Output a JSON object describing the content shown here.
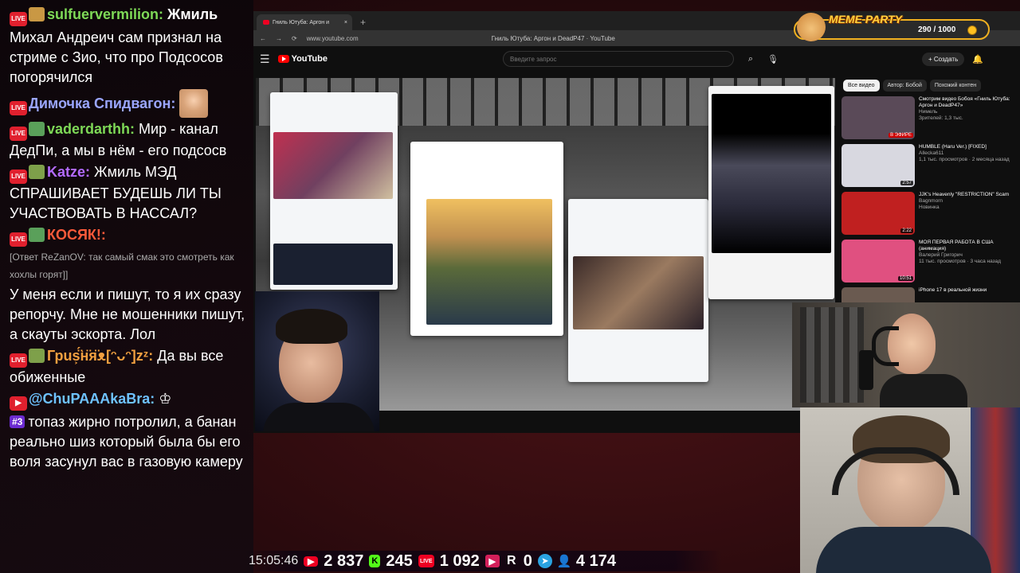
{
  "chat": {
    "messages": [
      {
        "badge": "LIVE",
        "user": "sulfuervermilion",
        "user_color": "#7ed957",
        "text": "Жмиль",
        "text_bold": true,
        "emote_color": "#c99844"
      },
      {
        "badge": "",
        "user": "",
        "text": "Михал Андреич сам признал на стриме с Зио, что про Подсосов погорячился"
      },
      {
        "badge": "LIVE",
        "user": "Димочка Спидвагон",
        "user_color": "#9aa6ff",
        "text": "",
        "has_avatar": true
      },
      {
        "badge": "LIVE",
        "user": "vaderdarthh",
        "user_color": "#7ed957",
        "text": "Мир - канал ДедПи, а мы в нём - его подсосв",
        "emote_color": "#5aa05a"
      },
      {
        "badge": "LIVE",
        "user": "Katze",
        "user_color": "#b36bff",
        "text": "Жмиль МЭД СПРАШИВАЕТ БУДЕШЬ ЛИ ТЫ УЧАСТВОВАТЬ В НАССАЛ?",
        "emote_color": "#7ea04a"
      },
      {
        "badge": "LIVE",
        "user": "КОСЯК!",
        "user_color": "#ff5a3a",
        "text": "",
        "emote_color": "#5aa05a"
      },
      {
        "reply": "[Ответ ReZanOV: так самый смак это смотреть как хохлы горят]]"
      },
      {
        "badge": "",
        "user": "",
        "text": "У меня если и пишут, то я их сразу репорчу. Мне не мошенники пишут, а скауты эскорта. Лол"
      },
      {
        "badge": "LIVE",
        "user": "Грus͕̈́̈͘н̈я̈ᴥ[ᵔᴗᵔ]zᶻ",
        "user_color": "#f2a040",
        "text": "Да вы все обиженные",
        "emote_color": "#7ea04a"
      },
      {
        "badge": "YT",
        "user": "@ChuPAAAkaBra",
        "user_color": "#6ec2ff",
        "text": "",
        "crown": "♔"
      },
      {
        "badge": "",
        "num": "#3",
        "user": "",
        "text": "топаз жирно потролил, а банан реально шиз который была бы его воля засунул вас в газовую камеру"
      }
    ]
  },
  "browser": {
    "tab_title": "Гниль Ютуба: Аргон и",
    "url": "www.youtube.com",
    "window_title": "Гниль Ютуба: Аргон и DeadP47 · YouTube",
    "search_placeholder": "Введите запрос",
    "create_label": "+ Создать",
    "logo": "YouTube",
    "chips": [
      "Все видео",
      "Автор: Бобой",
      "Похожий контен"
    ],
    "recommendations": [
      {
        "title": "Смотрим видео Бобоя «Гниль Ютуба: Аргон и DeadP47»",
        "channel": "Нимель",
        "meta": "Зрителей: 1,3 тыс.",
        "badge": "В ЭФИРЕ",
        "color": "#5a4a58"
      },
      {
        "title": "HUMBLE (Haru Ver.) [FIXED]",
        "channel": "Allecka611",
        "meta": "1,1 тыс. просмотров · 2 месяца назад",
        "duration": "2:57",
        "color": "#d8d8e0"
      },
      {
        "title": "JJK's Heavenly \"RESTRICTION\" Scam",
        "channel": "Bagnmorn",
        "meta": "Новинка",
        "duration": "2:22",
        "color": "#c02020"
      },
      {
        "title": "МОЯ ПЕРВАЯ РАБОТА В США (анимация)",
        "channel": "Валерий Григорич",
        "meta": "11 тыс. просмотров · 3 часа назад",
        "duration": "10:51",
        "color": "#e05080"
      },
      {
        "title": "iPhone 17 в реальной жизни",
        "channel": "",
        "meta": "",
        "color": "#6a5a50"
      }
    ]
  },
  "meme": {
    "title": "MEME PARTY",
    "score": "290 / 1000"
  },
  "stats": {
    "time": "15:05:46",
    "youtube": "2 837",
    "kick": "245",
    "live": "1 092",
    "rutube": "0",
    "total": "4 174"
  },
  "colors": {
    "accent_red": "#e0202e",
    "chat_bg": "#0c060a",
    "bg": "#2a0a0d"
  }
}
